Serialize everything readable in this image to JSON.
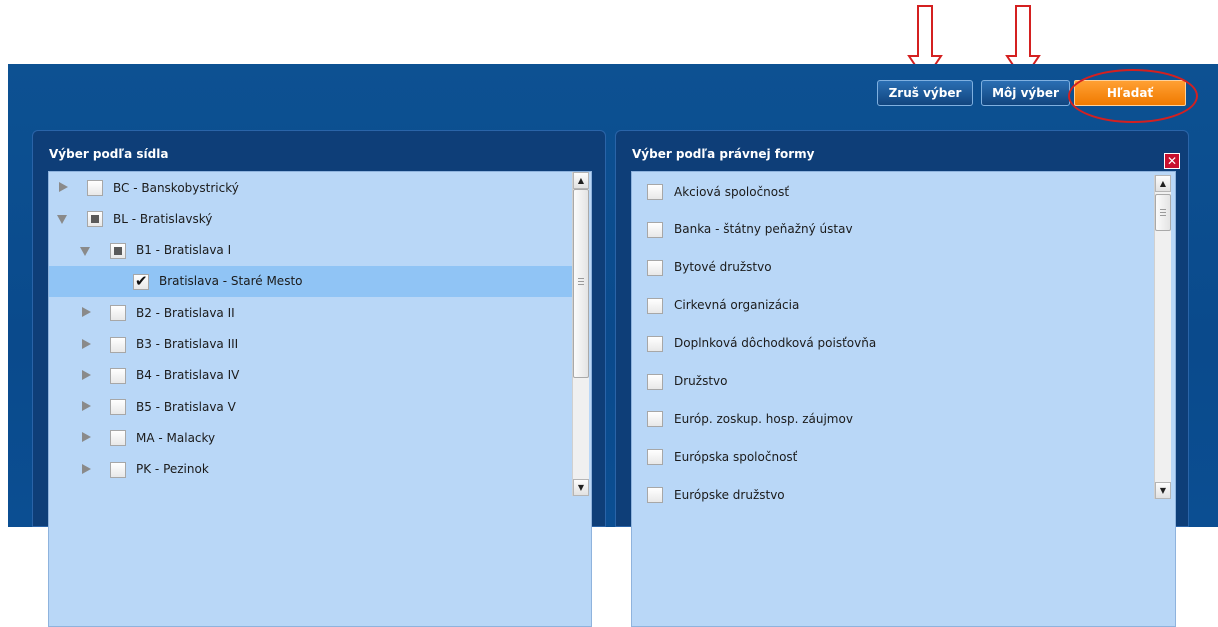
{
  "toolbar": {
    "clear_label": "Zruš výber",
    "my_selection_label": "Môj výber",
    "search_label": "Hľadať"
  },
  "left_panel": {
    "title": "Výber podľa sídla",
    "items": [
      {
        "label": "BC - Banskobystrický",
        "level": 0,
        "state": "unchecked",
        "expander": "collapsed"
      },
      {
        "label": "BL - Bratislavský",
        "level": 0,
        "state": "partial",
        "expander": "expanded"
      },
      {
        "label": "B1 - Bratislava I",
        "level": 1,
        "state": "partial",
        "expander": "expanded"
      },
      {
        "label": "Bratislava - Staré Mesto",
        "level": 2,
        "state": "checked",
        "expander": "none",
        "selected": true
      },
      {
        "label": "B2 - Bratislava II",
        "level": 1,
        "state": "unchecked",
        "expander": "collapsed"
      },
      {
        "label": "B3 - Bratislava III",
        "level": 1,
        "state": "unchecked",
        "expander": "collapsed"
      },
      {
        "label": "B4 - Bratislava IV",
        "level": 1,
        "state": "unchecked",
        "expander": "collapsed"
      },
      {
        "label": "B5 - Bratislava V",
        "level": 1,
        "state": "unchecked",
        "expander": "collapsed"
      },
      {
        "label": "MA - Malacky",
        "level": 1,
        "state": "unchecked",
        "expander": "collapsed"
      },
      {
        "label": "PK - Pezinok",
        "level": 1,
        "state": "unchecked",
        "expander": "collapsed"
      }
    ]
  },
  "right_panel": {
    "title": "Výber podľa právnej formy",
    "items": [
      {
        "label": "Akciová spoločnosť",
        "state": "unchecked"
      },
      {
        "label": "Banka - štátny peňažný ústav",
        "state": "unchecked"
      },
      {
        "label": "Bytové družstvo",
        "state": "unchecked"
      },
      {
        "label": "Cirkevná organizácia",
        "state": "unchecked"
      },
      {
        "label": "Doplnková dôchodková poisťovňa",
        "state": "unchecked"
      },
      {
        "label": "Družstvo",
        "state": "unchecked"
      },
      {
        "label": "Európ. zoskup. hosp. záujmov",
        "state": "unchecked"
      },
      {
        "label": "Európska spoločnosť",
        "state": "unchecked"
      },
      {
        "label": "Európske družstvo",
        "state": "unchecked"
      }
    ]
  },
  "colors": {
    "frame_blue": "#0b4e92",
    "list_blue": "#b9d7f7",
    "selected_row": "#90c4f5",
    "accent_orange": "#f58a0e",
    "annotation_red": "#d42020"
  },
  "icons": {
    "close": "close-icon",
    "annotation_arrow": "arrow-down-icon"
  }
}
